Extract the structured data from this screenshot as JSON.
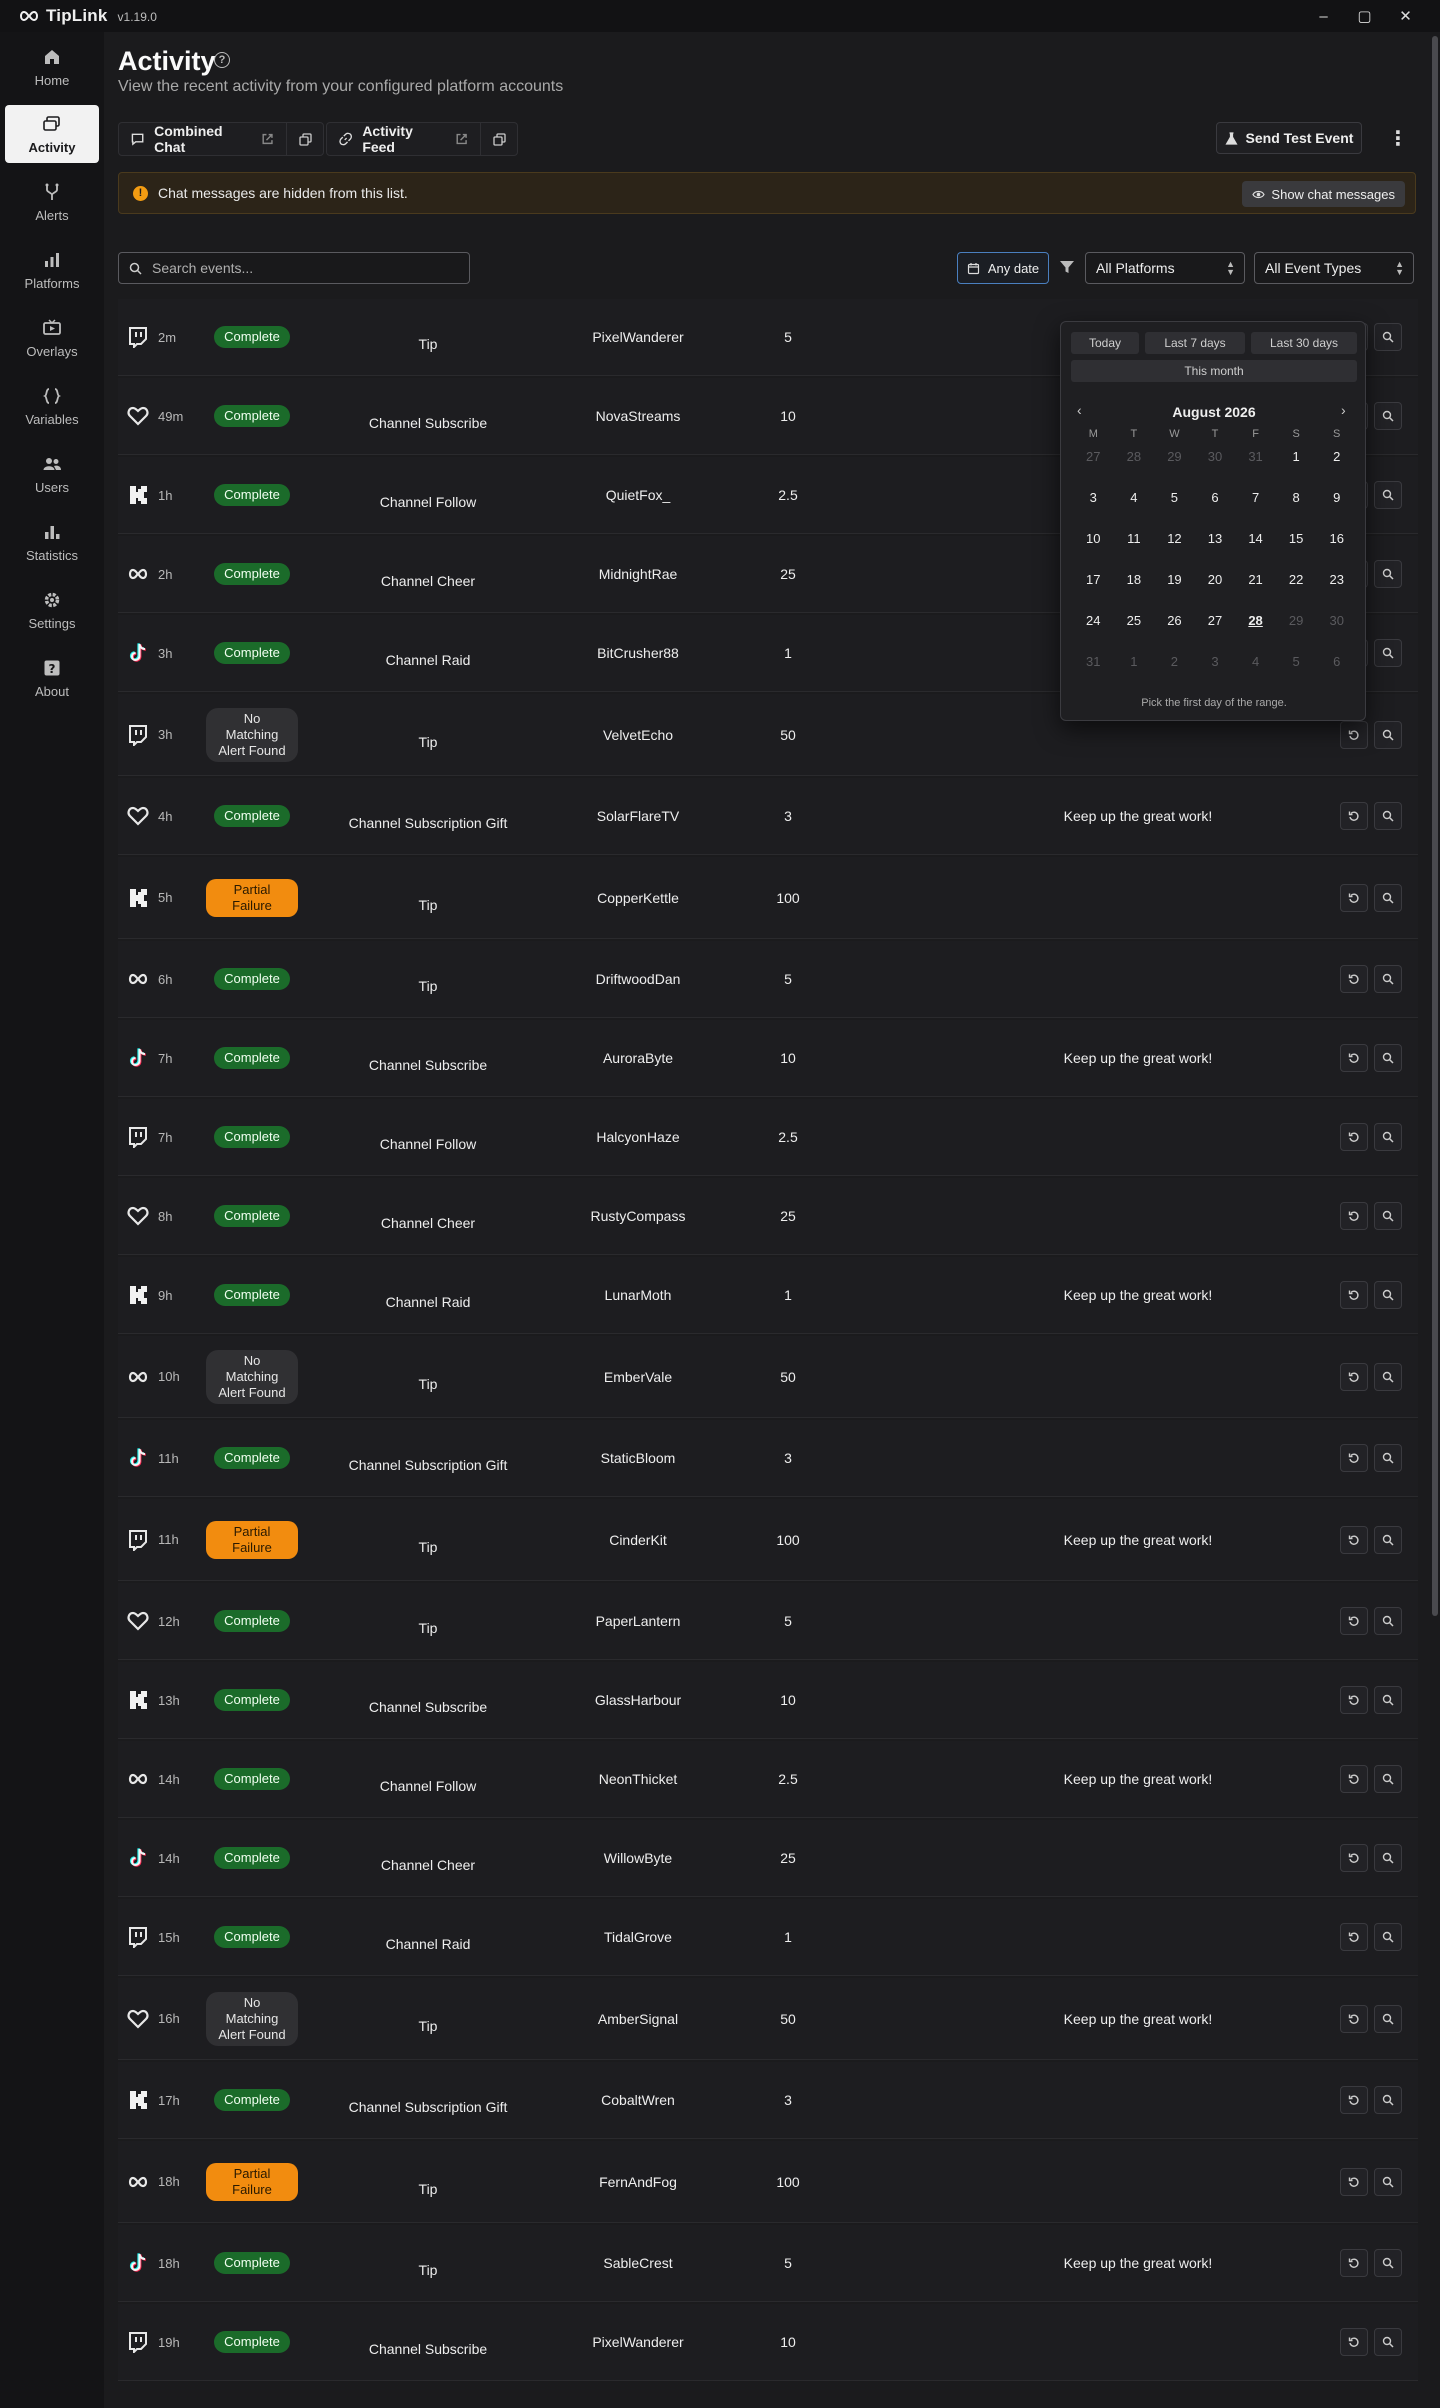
{
  "app": {
    "name": "TipLink",
    "version": "v1.19.0"
  },
  "window": {
    "minimize": "–",
    "maximize": "▢",
    "close": "✕"
  },
  "sidebar": {
    "items": [
      {
        "label": "Home",
        "icon": "home-icon"
      },
      {
        "label": "Activity",
        "icon": "activity-icon",
        "active": true
      },
      {
        "label": "Alerts",
        "icon": "alerts-icon"
      },
      {
        "label": "Platforms",
        "icon": "platforms-icon"
      },
      {
        "label": "Overlays",
        "icon": "overlays-icon"
      },
      {
        "label": "Variables",
        "icon": "variables-icon"
      },
      {
        "label": "Users",
        "icon": "users-icon"
      },
      {
        "label": "Statistics",
        "icon": "statistics-icon"
      },
      {
        "label": "Settings",
        "icon": "settings-icon"
      },
      {
        "label": "About",
        "icon": "about-icon"
      }
    ]
  },
  "header": {
    "title": "Activity",
    "help": "?",
    "subtitle": "View the recent activity from your configured platform accounts"
  },
  "toolbar": {
    "combined_chat": "Combined Chat",
    "activity_feed": "Activity Feed",
    "send_test": "Send Test Event",
    "more": "⋮"
  },
  "banner": {
    "icon": "!",
    "text": "Chat messages are hidden from this list.",
    "button": "Show chat messages",
    "colors": {
      "warning": "#f39c12"
    }
  },
  "filters": {
    "search_placeholder": "Search events...",
    "date": "Any date",
    "platform": "All Platforms",
    "event_type": "All Event Types"
  },
  "datepicker": {
    "presets": [
      "Today",
      "Last 7 days",
      "Last 30 days",
      "This month"
    ],
    "month": "August 2026",
    "dow": [
      "M",
      "T",
      "W",
      "T",
      "F",
      "S",
      "S"
    ],
    "days": [
      {
        "d": "27",
        "m": true
      },
      {
        "d": "28",
        "m": true
      },
      {
        "d": "29",
        "m": true
      },
      {
        "d": "30",
        "m": true
      },
      {
        "d": "31",
        "m": true
      },
      {
        "d": "1"
      },
      {
        "d": "2"
      },
      {
        "d": "3"
      },
      {
        "d": "4"
      },
      {
        "d": "5"
      },
      {
        "d": "6"
      },
      {
        "d": "7"
      },
      {
        "d": "8"
      },
      {
        "d": "9"
      },
      {
        "d": "10"
      },
      {
        "d": "11"
      },
      {
        "d": "12"
      },
      {
        "d": "13"
      },
      {
        "d": "14"
      },
      {
        "d": "15"
      },
      {
        "d": "16"
      },
      {
        "d": "17"
      },
      {
        "d": "18"
      },
      {
        "d": "19"
      },
      {
        "d": "20"
      },
      {
        "d": "21"
      },
      {
        "d": "22"
      },
      {
        "d": "23"
      },
      {
        "d": "24"
      },
      {
        "d": "25"
      },
      {
        "d": "26"
      },
      {
        "d": "27"
      },
      {
        "d": "28",
        "t": true
      },
      {
        "d": "29",
        "m": true
      },
      {
        "d": "30",
        "m": true
      },
      {
        "d": "31",
        "m": true
      },
      {
        "d": "1",
        "m": true
      },
      {
        "d": "2",
        "m": true
      },
      {
        "d": "3",
        "m": true
      },
      {
        "d": "4",
        "m": true
      },
      {
        "d": "5",
        "m": true
      },
      {
        "d": "6",
        "m": true
      }
    ],
    "hint": "Pick the first day of the range."
  },
  "status_colors": {
    "complete": "#1b6b2a",
    "partial": "#f28c0f",
    "none": "#303033"
  },
  "events": [
    {
      "platform": "twitch",
      "age": "2m",
      "status": "Complete",
      "type": "Tip",
      "user": "PixelWanderer",
      "amount": "5",
      "message": ""
    },
    {
      "platform": "heart",
      "age": "49m",
      "status": "Complete",
      "type": "Channel Subscribe",
      "user": "NovaStreams",
      "amount": "10",
      "message": ""
    },
    {
      "platform": "kick",
      "age": "1h",
      "status": "Complete",
      "type": "Channel Follow",
      "user": "QuietFox_",
      "amount": "2.5",
      "message": ""
    },
    {
      "platform": "infinity",
      "age": "2h",
      "status": "Complete",
      "type": "Channel Cheer",
      "user": "MidnightRae",
      "amount": "25",
      "message": ""
    },
    {
      "platform": "tiktok",
      "age": "3h",
      "status": "Complete",
      "type": "Channel Raid",
      "user": "BitCrusher88",
      "amount": "1",
      "message": ""
    },
    {
      "platform": "twitch",
      "age": "3h",
      "status": "No Matching Alert Found",
      "type": "Tip",
      "user": "VelvetEcho",
      "amount": "50",
      "message": ""
    },
    {
      "platform": "heart",
      "age": "4h",
      "status": "Complete",
      "type": "Channel Subscription Gift",
      "user": "SolarFlareTV",
      "amount": "3",
      "message": "Keep up the great work!"
    },
    {
      "platform": "kick",
      "age": "5h",
      "status": "Partial Failure",
      "type": "Tip",
      "user": "CopperKettle",
      "amount": "100",
      "message": ""
    },
    {
      "platform": "infinity",
      "age": "6h",
      "status": "Complete",
      "type": "Tip",
      "user": "DriftwoodDan",
      "amount": "5",
      "message": ""
    },
    {
      "platform": "tiktok",
      "age": "7h",
      "status": "Complete",
      "type": "Channel Subscribe",
      "user": "AuroraByte",
      "amount": "10",
      "message": "Keep up the great work!"
    },
    {
      "platform": "twitch",
      "age": "7h",
      "status": "Complete",
      "type": "Channel Follow",
      "user": "HalcyonHaze",
      "amount": "2.5",
      "message": ""
    },
    {
      "platform": "heart",
      "age": "8h",
      "status": "Complete",
      "type": "Channel Cheer",
      "user": "RustyCompass",
      "amount": "25",
      "message": ""
    },
    {
      "platform": "kick",
      "age": "9h",
      "status": "Complete",
      "type": "Channel Raid",
      "user": "LunarMoth",
      "amount": "1",
      "message": "Keep up the great work!"
    },
    {
      "platform": "infinity",
      "age": "10h",
      "status": "No Matching Alert Found",
      "type": "Tip",
      "user": "EmberVale",
      "amount": "50",
      "message": ""
    },
    {
      "platform": "tiktok",
      "age": "11h",
      "status": "Complete",
      "type": "Channel Subscription Gift",
      "user": "StaticBloom",
      "amount": "3",
      "message": ""
    },
    {
      "platform": "twitch",
      "age": "11h",
      "status": "Partial Failure",
      "type": "Tip",
      "user": "CinderKit",
      "amount": "100",
      "message": "Keep up the great work!"
    },
    {
      "platform": "heart",
      "age": "12h",
      "status": "Complete",
      "type": "Tip",
      "user": "PaperLantern",
      "amount": "5",
      "message": ""
    },
    {
      "platform": "kick",
      "age": "13h",
      "status": "Complete",
      "type": "Channel Subscribe",
      "user": "GlassHarbour",
      "amount": "10",
      "message": ""
    },
    {
      "platform": "infinity",
      "age": "14h",
      "status": "Complete",
      "type": "Channel Follow",
      "user": "NeonThicket",
      "amount": "2.5",
      "message": "Keep up the great work!"
    },
    {
      "platform": "tiktok",
      "age": "14h",
      "status": "Complete",
      "type": "Channel Cheer",
      "user": "WillowByte",
      "amount": "25",
      "message": ""
    },
    {
      "platform": "twitch",
      "age": "15h",
      "status": "Complete",
      "type": "Channel Raid",
      "user": "TidalGrove",
      "amount": "1",
      "message": ""
    },
    {
      "platform": "heart",
      "age": "16h",
      "status": "No Matching Alert Found",
      "type": "Tip",
      "user": "AmberSignal",
      "amount": "50",
      "message": "Keep up the great work!"
    },
    {
      "platform": "kick",
      "age": "17h",
      "status": "Complete",
      "type": "Channel Subscription Gift",
      "user": "CobaltWren",
      "amount": "3",
      "message": ""
    },
    {
      "platform": "infinity",
      "age": "18h",
      "status": "Partial Failure",
      "type": "Tip",
      "user": "FernAndFog",
      "amount": "100",
      "message": ""
    },
    {
      "platform": "tiktok",
      "age": "18h",
      "status": "Complete",
      "type": "Tip",
      "user": "SableCrest",
      "amount": "5",
      "message": "Keep up the great work!"
    },
    {
      "platform": "twitch",
      "age": "19h",
      "status": "Complete",
      "type": "Channel Subscribe",
      "user": "PixelWanderer",
      "amount": "10",
      "message": ""
    }
  ]
}
